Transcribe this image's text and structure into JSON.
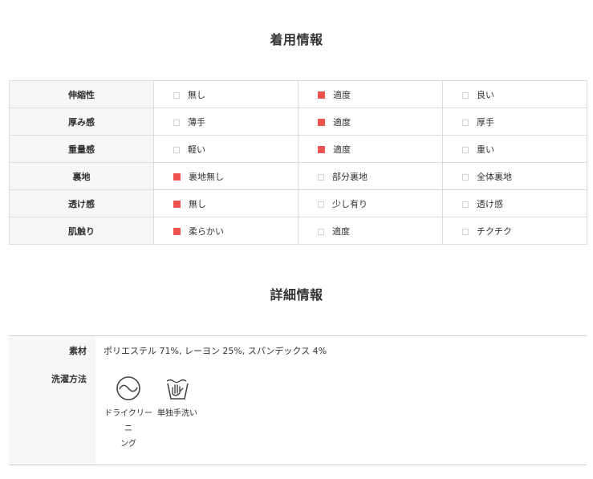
{
  "wear_info": {
    "title": "着用情報",
    "rows": [
      {
        "label": "伸縮性",
        "options": [
          {
            "text": "無し",
            "checked": false
          },
          {
            "text": "適度",
            "checked": true
          },
          {
            "text": "良い",
            "checked": false
          }
        ]
      },
      {
        "label": "厚み感",
        "options": [
          {
            "text": "薄手",
            "checked": false
          },
          {
            "text": "適度",
            "checked": true
          },
          {
            "text": "厚手",
            "checked": false
          }
        ]
      },
      {
        "label": "重量感",
        "options": [
          {
            "text": "軽い",
            "checked": false
          },
          {
            "text": "適度",
            "checked": true
          },
          {
            "text": "重い",
            "checked": false
          }
        ]
      },
      {
        "label": "裏地",
        "options": [
          {
            "text": "裏地無し",
            "checked": true
          },
          {
            "text": "部分裏地",
            "checked": false
          },
          {
            "text": "全体裏地",
            "checked": false
          }
        ]
      },
      {
        "label": "透け感",
        "options": [
          {
            "text": "無し",
            "checked": true
          },
          {
            "text": "少し有り",
            "checked": false
          },
          {
            "text": "透け感",
            "checked": false
          }
        ]
      },
      {
        "label": "肌触り",
        "options": [
          {
            "text": "柔らかい",
            "checked": true
          },
          {
            "text": "適度",
            "checked": false
          },
          {
            "text": "チクチク",
            "checked": false
          }
        ]
      }
    ]
  },
  "detail_info": {
    "title": "詳細情報",
    "material_label": "素材",
    "material_value": "ポリエステル 71%, レーヨン 25%, スパンデックス 4%",
    "washing_label": "洗濯方法",
    "washing_methods": [
      {
        "icon": "dry-cleaning-icon",
        "label_line1": "ドライクリーニ",
        "label_line2": "ング"
      },
      {
        "icon": "hand-wash-icon",
        "label_line1": "単独手洗い",
        "label_line2": ""
      }
    ]
  },
  "colors": {
    "checked": "#ef5350",
    "label_bg": "#f7f7f7",
    "border": "#dcdcdc"
  }
}
